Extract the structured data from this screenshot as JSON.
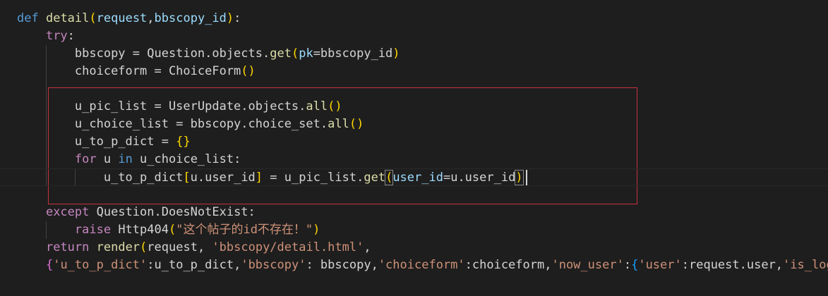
{
  "editor": {
    "language": "python",
    "theme": "dark",
    "colors": {
      "background": "#1e1e1e",
      "keyword": "#569cd6",
      "control": "#c586c0",
      "function": "#dcdcaa",
      "variable": "#9cdcfe",
      "class": "#4ec9b0",
      "string": "#ce9178",
      "bracket_1": "#ffd700",
      "bracket_2": "#da70d6",
      "bracket_3": "#179fff",
      "highlight_box": "#c8323c"
    },
    "lines": [
      {
        "indent": 0,
        "tokens": [
          {
            "t": "def",
            "c": "kw"
          },
          {
            "t": " ",
            "c": "txt"
          },
          {
            "t": "detail",
            "c": "fn"
          },
          {
            "t": "(",
            "c": "p1"
          },
          {
            "t": "request",
            "c": "var"
          },
          {
            "t": ",",
            "c": "txt"
          },
          {
            "t": "bbscopy_id",
            "c": "var"
          },
          {
            "t": ")",
            "c": "p1"
          },
          {
            "t": ":",
            "c": "txt"
          }
        ]
      },
      {
        "indent": 1,
        "tokens": [
          {
            "t": "try",
            "c": "ctl"
          },
          {
            "t": ":",
            "c": "txt"
          }
        ]
      },
      {
        "indent": 2,
        "tokens": [
          {
            "t": "bbscopy = Question.objects.",
            "c": "txt"
          },
          {
            "t": "get",
            "c": "fn"
          },
          {
            "t": "(",
            "c": "p1"
          },
          {
            "t": "pk",
            "c": "var"
          },
          {
            "t": "=bbscopy_id",
            "c": "txt"
          },
          {
            "t": ")",
            "c": "p1"
          }
        ]
      },
      {
        "indent": 2,
        "tokens": [
          {
            "t": "choiceform = ChoiceForm",
            "c": "txt"
          },
          {
            "t": "(",
            "c": "p1"
          },
          {
            "t": ")",
            "c": "p1"
          }
        ]
      },
      {
        "indent": 0,
        "tokens": []
      },
      {
        "indent": 2,
        "tokens": [
          {
            "t": "u_pic_list = UserUpdate.objects.",
            "c": "txt"
          },
          {
            "t": "all",
            "c": "fn"
          },
          {
            "t": "(",
            "c": "p1"
          },
          {
            "t": ")",
            "c": "p1"
          }
        ]
      },
      {
        "indent": 2,
        "tokens": [
          {
            "t": "u_choice_list = bbscopy.choice_set.",
            "c": "txt"
          },
          {
            "t": "all",
            "c": "fn"
          },
          {
            "t": "(",
            "c": "p1"
          },
          {
            "t": ")",
            "c": "p1"
          }
        ]
      },
      {
        "indent": 2,
        "tokens": [
          {
            "t": "u_to_p_dict = ",
            "c": "txt"
          },
          {
            "t": "{",
            "c": "p1"
          },
          {
            "t": "}",
            "c": "p1"
          }
        ]
      },
      {
        "indent": 2,
        "tokens": [
          {
            "t": "for",
            "c": "ctl"
          },
          {
            "t": " u ",
            "c": "txt"
          },
          {
            "t": "in",
            "c": "kw"
          },
          {
            "t": " u_choice_list:",
            "c": "txt"
          }
        ]
      },
      {
        "indent": 3,
        "current": true,
        "tokens": [
          {
            "t": "u_to_p_dict",
            "c": "txt"
          },
          {
            "t": "[",
            "c": "p1"
          },
          {
            "t": "u.user_id",
            "c": "txt"
          },
          {
            "t": "]",
            "c": "p1"
          },
          {
            "t": " = u_pic_list.",
            "c": "txt"
          },
          {
            "t": "get",
            "c": "fn"
          },
          {
            "t": "(",
            "c": "p1",
            "m": true
          },
          {
            "t": "user_id",
            "c": "var"
          },
          {
            "t": "=u.user_id",
            "c": "txt"
          },
          {
            "t": ")",
            "c": "p1",
            "m": true
          }
        ]
      },
      {
        "indent": 0,
        "tokens": []
      },
      {
        "indent": 1,
        "tokens": [
          {
            "t": "except",
            "c": "ctl"
          },
          {
            "t": " Question.DoesNotExist:",
            "c": "txt"
          }
        ]
      },
      {
        "indent": 2,
        "tokens": [
          {
            "t": "raise",
            "c": "ctl"
          },
          {
            "t": " Http404",
            "c": "txt"
          },
          {
            "t": "(",
            "c": "p1"
          },
          {
            "t": "\"这个帖子的id不存在！\"",
            "c": "str"
          },
          {
            "t": ")",
            "c": "p1"
          }
        ]
      },
      {
        "indent": 1,
        "tokens": [
          {
            "t": "return",
            "c": "ctl"
          },
          {
            "t": " ",
            "c": "txt"
          },
          {
            "t": "render",
            "c": "fn"
          },
          {
            "t": "(",
            "c": "p1"
          },
          {
            "t": "request, ",
            "c": "txt"
          },
          {
            "t": "'bbscopy/detail.html'",
            "c": "str"
          },
          {
            "t": ",",
            "c": "txt"
          }
        ]
      },
      {
        "indent": 1,
        "tokens": [
          {
            "t": "{",
            "c": "p2"
          },
          {
            "t": "'u_to_p_dict'",
            "c": "str"
          },
          {
            "t": ":u_to_p_dict,",
            "c": "txt"
          },
          {
            "t": "'bbscopy'",
            "c": "str"
          },
          {
            "t": ": bbscopy,",
            "c": "txt"
          },
          {
            "t": "'choiceform'",
            "c": "str"
          },
          {
            "t": ":choiceform,",
            "c": "txt"
          },
          {
            "t": "'now_user'",
            "c": "str"
          },
          {
            "t": ":",
            "c": "txt"
          },
          {
            "t": "{",
            "c": "p3"
          },
          {
            "t": "'user'",
            "c": "str"
          },
          {
            "t": ":request.user,",
            "c": "txt"
          },
          {
            "t": "'is_login'",
            "c": "str"
          }
        ]
      }
    ]
  }
}
